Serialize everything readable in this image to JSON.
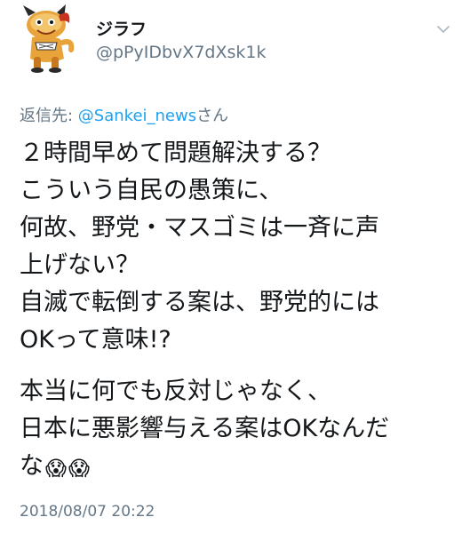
{
  "author": {
    "display_name": "ジラフ",
    "handle": "@pPyIDbvX7dXsk1k",
    "avatar_icon": "giraffe-mascot-icon"
  },
  "reply": {
    "prefix": "返信先: ",
    "mention": "@Sankei_news",
    "suffix": "さん"
  },
  "tweet_lines": [
    "２時間早めて問題解決する？",
    "こういう自民の愚策に、",
    "何故、野党・マスゴミは一斉に声",
    "上げない？",
    "自滅で転倒する案は、野党的には",
    "OKって意味!?",
    "本当に何でも反対じゃなく、",
    "日本に悪影響与える案はOKなんだ",
    "な"
  ],
  "emojis": [
    "😱",
    "😱"
  ],
  "timestamp": "2018/08/07 20:22",
  "menu_icon": "chevron-down-icon",
  "colors": {
    "text": "#14171a",
    "secondary": "#657786",
    "link": "#1da1f2"
  }
}
